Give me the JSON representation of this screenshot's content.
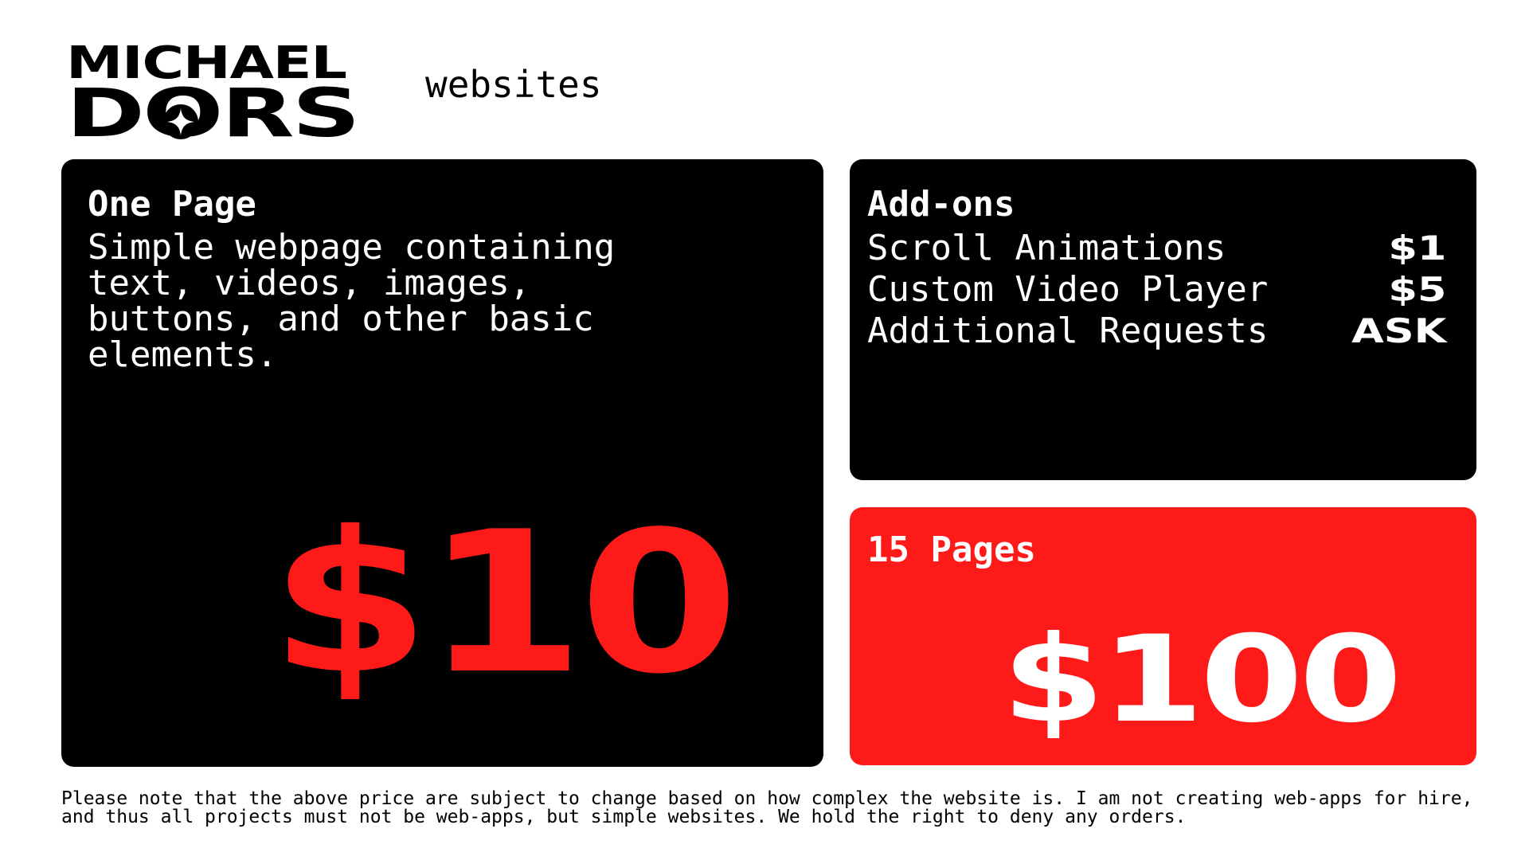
{
  "brand": {
    "name_line1": "MICHAEL",
    "name_line2": "DORS",
    "subtitle": "websites"
  },
  "colors": {
    "accent_red": "#ff1a1a",
    "card_black": "#000000",
    "background": "#ffffff"
  },
  "icons": {
    "logo_star": "four-point-star-icon"
  },
  "one_page": {
    "title": "One Page",
    "description": "Simple webpage containing text, videos, images, buttons, and other basic elements.",
    "price": "$10"
  },
  "addons": {
    "title": "Add-ons",
    "items": [
      {
        "label": "Scroll Animations",
        "price": "$1"
      },
      {
        "label": "Custom Video Player",
        "price": "$5"
      },
      {
        "label": "Additional Requests",
        "price": "ASK"
      }
    ]
  },
  "fifteen_pages": {
    "title": "15 Pages",
    "price": "$100"
  },
  "footer": {
    "note": "Please note that the above price are subject to change based on how complex the website is. I am not creating web-apps for hire, and thus all projects must not be web-apps, but simple websites. We hold the right to deny any orders."
  }
}
